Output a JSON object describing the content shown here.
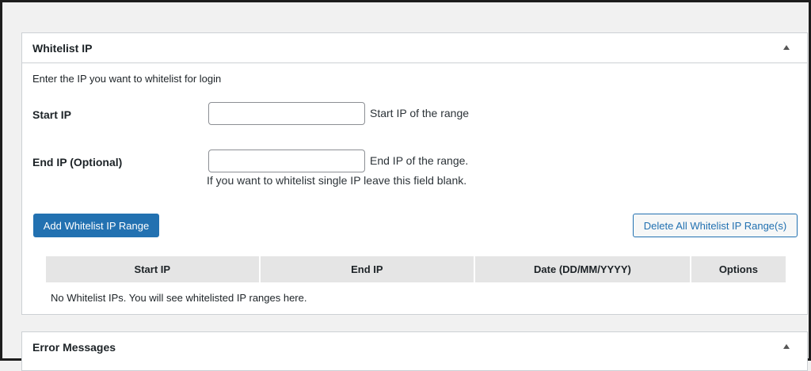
{
  "whitelist_panel": {
    "title": "Whitelist IP",
    "toggle_icon": "arrow-up-icon",
    "intro": "Enter the IP you want to whitelist for login",
    "start_ip": {
      "label": "Start IP",
      "value": "",
      "description": "Start IP of the range"
    },
    "end_ip": {
      "label": "End IP (Optional)",
      "value": "",
      "description_line1": "End IP of the range.",
      "description_line2": "If you want to whitelist single IP leave this field blank."
    },
    "add_button": "Add Whitelist IP Range",
    "delete_all_button": "Delete All Whitelist IP Range(s)",
    "table": {
      "headers": [
        "Start IP",
        "End IP",
        "Date (DD/MM/YYYY)",
        "Options"
      ],
      "empty_message": "No Whitelist IPs. You will see whitelisted IP ranges here."
    }
  },
  "error_panel": {
    "title": "Error Messages",
    "toggle_icon": "arrow-up-icon"
  },
  "colors": {
    "primary": "#2271b1",
    "page_background": "#f1f1f1",
    "table_header_bg": "#e5e5e5"
  }
}
